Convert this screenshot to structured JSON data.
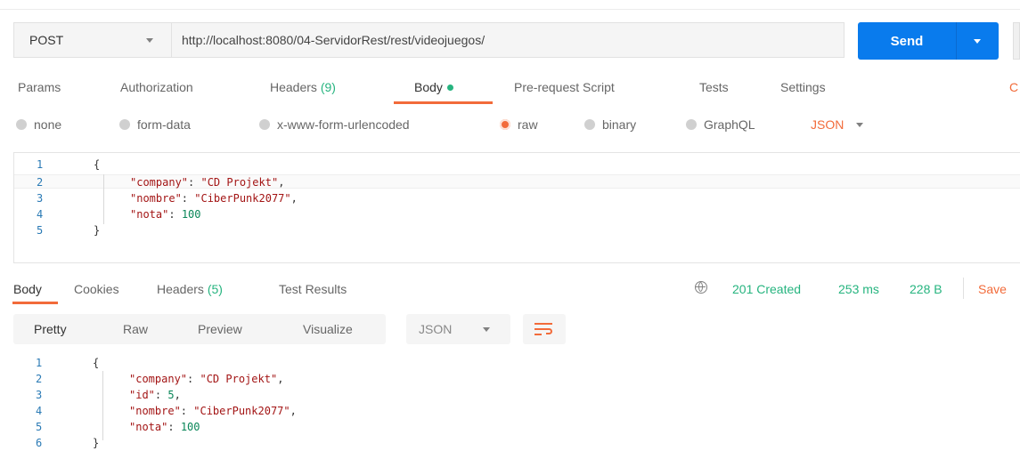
{
  "request": {
    "method": "POST",
    "url": "http://localhost:8080/04-ServidorRest/rest/videojuegos/",
    "send_label": "Send"
  },
  "request_tabs": [
    {
      "label": "Params"
    },
    {
      "label": "Authorization"
    },
    {
      "label": "Headers",
      "count": "(9)"
    },
    {
      "label": "Body",
      "active": true
    },
    {
      "label": "Pre-request Script"
    },
    {
      "label": "Tests"
    },
    {
      "label": "Settings"
    }
  ],
  "request_tabs_edge": "C",
  "body_types": [
    {
      "label": "none"
    },
    {
      "label": "form-data"
    },
    {
      "label": "x-www-form-urlencoded"
    },
    {
      "label": "raw",
      "selected": true
    },
    {
      "label": "binary"
    },
    {
      "label": "GraphQL"
    }
  ],
  "body_format": "JSON",
  "request_body": {
    "line_numbers": [
      "1",
      "2",
      "3",
      "4",
      "5"
    ],
    "open_brace": "{",
    "close_brace": "}",
    "lines": [
      {
        "key": "\"company\"",
        "value": "\"CD Projekt\"",
        "trail": ","
      },
      {
        "key": "\"nombre\"",
        "value": "\"CiberPunk2077\"",
        "trail": ","
      },
      {
        "key": "\"nota\"",
        "value": "100",
        "trail": ""
      }
    ]
  },
  "response_tabs": [
    {
      "label": "Body",
      "active": true
    },
    {
      "label": "Cookies"
    },
    {
      "label": "Headers",
      "count": "(5)"
    },
    {
      "label": "Test Results"
    }
  ],
  "response_status": {
    "status": "201 Created",
    "time": "253 ms",
    "size": "228 B",
    "save_label": "Save"
  },
  "response_view": {
    "modes": [
      "Pretty",
      "Raw",
      "Preview",
      "Visualize"
    ],
    "active_mode": "Pretty",
    "format": "JSON"
  },
  "response_body": {
    "line_numbers": [
      "1",
      "2",
      "3",
      "4",
      "5",
      "6"
    ],
    "open_brace": "{",
    "close_brace": "}",
    "lines": [
      {
        "key": "\"company\"",
        "value": "\"CD Projekt\"",
        "trail": ","
      },
      {
        "key": "\"id\"",
        "value": "5",
        "trail": ","
      },
      {
        "key": "\"nombre\"",
        "value": "\"CiberPunk2077\"",
        "trail": ","
      },
      {
        "key": "\"nota\"",
        "value": "100",
        "trail": ""
      }
    ]
  },
  "colors": {
    "accent": "#f26b3a",
    "primary": "#097bed",
    "success": "#26b47f"
  },
  "icons": {
    "method_dropdown": "chevron-down-icon",
    "send_dropdown": "chevron-down-icon",
    "globe": "globe-icon",
    "wrap": "wrap-lines-icon"
  }
}
